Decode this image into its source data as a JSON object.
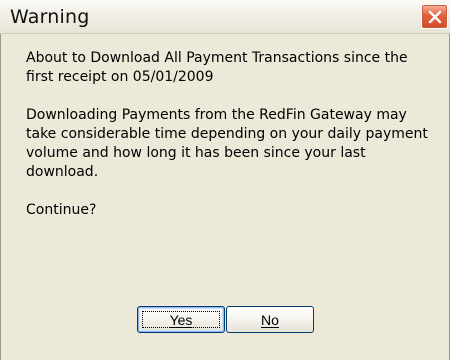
{
  "window": {
    "title": "Warning",
    "close_icon": "close-icon"
  },
  "message": {
    "line_1": "About to Download All Payment Transactions since the first receipt on 05/01/2009",
    "line_2": "Downloading Payments from the RedFin Gateway may take considerable time depending on your daily payment volume and how long it has been since your last download.",
    "line_3": "Continue?"
  },
  "buttons": {
    "yes": "Yes",
    "no": "No"
  },
  "colors": {
    "dialog_background": "#ece9d8",
    "close_button": "#d64a2b",
    "button_border": "#003c74"
  }
}
